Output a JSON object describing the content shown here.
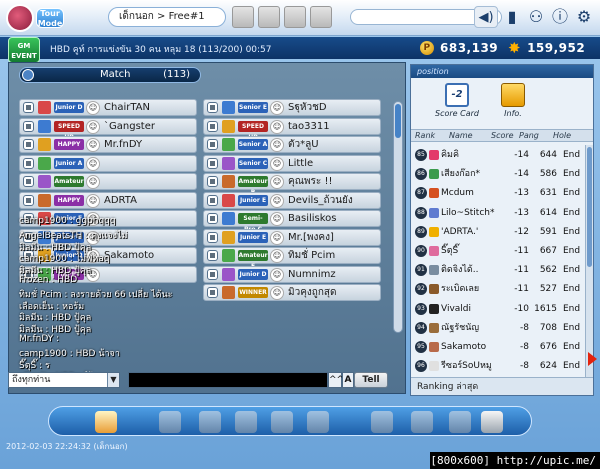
{
  "header": {
    "logo_text": "Tour Mode",
    "room_title": "เด็กนอก > Free#1",
    "buttons": {
      "speaker": "speaker-icon"
    }
  },
  "infobar": {
    "gm_label": "GM EVENT",
    "room_info": "HBD คูท์    การแข่งขัน 30 คน    หลุม 18  (113/200)  00:57",
    "coins": "683,139",
    "stars": "159,952"
  },
  "main_tab": {
    "label": "Match",
    "count": "(113)"
  },
  "left_rows": [
    {
      "name": "ChairTAN",
      "rank": "Junior D",
      "color": "#2b62b8"
    },
    {
      "name": "`Gangster",
      "rank": "SPEED UP",
      "color": "#b32424"
    },
    {
      "name": "Mr.fnDY",
      "rank": "HAPPY",
      "color": "#8b2fa6"
    },
    {
      "name": "",
      "rank": "Junior A",
      "color": "#2b62b8"
    },
    {
      "name": "",
      "rank": "Amateur",
      "color": "#2e7a2e"
    },
    {
      "name": "ADRTA",
      "rank": "HAPPY",
      "color": "#8b2fa6"
    },
    {
      "name": "",
      "rank": "Junior E",
      "color": "#2b62b8"
    },
    {
      "name": "",
      "rank": "Junior E",
      "color": "#2b62b8"
    },
    {
      "name": "Sakamoto",
      "rank": "Junior D",
      "color": "#2b62b8"
    },
    {
      "name": "",
      "rank": "HAPPY",
      "color": "#8b2fa6"
    }
  ],
  "right_rows": [
    {
      "name": "SฐุหัวชD",
      "rank": "Senior E",
      "color": "#2b62b8"
    },
    {
      "name": "tao3311",
      "rank": "SPEED UP",
      "color": "#b32424"
    },
    {
      "name": "ตัว*ลูU",
      "rank": "Senior A",
      "color": "#2b62b8"
    },
    {
      "name": "Little",
      "rank": "Senior C",
      "color": "#2b62b8"
    },
    {
      "name": "คุณพระ !!",
      "rank": "Amateur B",
      "color": "#2e7a2e"
    },
    {
      "name": "Devils_ถ้วนยัง",
      "rank": "Junior E",
      "color": "#2b62b8"
    },
    {
      "name": "Basiliskos",
      "rank": "Semi-Pro C",
      "color": "#2e7a2e"
    },
    {
      "name": "Mr.[พงคง]",
      "rank": "Junior E",
      "color": "#2b62b8"
    },
    {
      "name": "ทิมชั่ Pcim",
      "rank": "Amateur E",
      "color": "#2e7a2e"
    },
    {
      "name": "Numnimz",
      "rank": "Junior D",
      "color": "#2b62b8"
    },
    {
      "name": "มิวคุงถูกสุด",
      "rank": "WINNER",
      "color": "#c28800"
    }
  ],
  "chat": [
    "camp1900 : ggphqqq",
    "AngelBeatsTH : คุงแจงไม่",
    "มิลมีน : HBD ปู้คุล",
    "camp1900 : ไม่ฟหaq",
    "มิลมีน : HBD ปู้คุล",
    "Frozen : HBD",
    "ทิมชั่ Pcim : ลงรายด้วย 66 เปลี่ย ได้นะ",
    "เลือดเย็น : หอร้ม",
    "มิลมีน : HBD ปู้คุล",
    "มิลมีน : HBD ปู้คุล",
    "Mr.fnDY :",
    "camp1900 : HBD น้าจา",
    "Sิ๊ตุSิ๊ : ร",
    "zFord! : HBDคูท์ว้าาา"
  ],
  "input": {
    "channel": "ถึงทุกท่าน",
    "bold_label": "A",
    "size_label": "^^",
    "tell_label": "Tell"
  },
  "rank_panel": {
    "title": "position",
    "score_card_label": "Score Card",
    "score_card_value": "-2",
    "info_label": "Info.",
    "columns": [
      "Rank",
      "Name",
      "Score",
      "Pang",
      "Hole"
    ],
    "rows": [
      {
        "rank": "85",
        "name": "คิมคิ",
        "score": "-14",
        "pang": "644",
        "hole": "End"
      },
      {
        "rank": "86",
        "name": "เสียงก๊อก*",
        "score": "-14",
        "pang": "586",
        "hole": "End"
      },
      {
        "rank": "87",
        "name": "Mcdum",
        "score": "-13",
        "pang": "631",
        "hole": "End"
      },
      {
        "rank": "88",
        "name": "Lilo~Stitch*",
        "score": "-13",
        "pang": "614",
        "hole": "End"
      },
      {
        "rank": "89",
        "name": "'ADRTA.'",
        "score": "-12",
        "pang": "591",
        "hole": "End"
      },
      {
        "rank": "90",
        "name": "Sิ๊ตุSิ๊",
        "score": "-11",
        "pang": "667",
        "hole": "End"
      },
      {
        "rank": "91",
        "name": "ติดจิงได้..",
        "score": "-11",
        "pang": "562",
        "hole": "End"
      },
      {
        "rank": "92",
        "name": "ระเบิดเลย",
        "score": "-11",
        "pang": "527",
        "hole": "End"
      },
      {
        "rank": "93",
        "name": "Vivaldi",
        "score": "-10",
        "pang": "1615",
        "hole": "End"
      },
      {
        "rank": "94",
        "name": "ณัฐรัชนัญ",
        "score": "-8",
        "pang": "708",
        "hole": "End"
      },
      {
        "rank": "95",
        "name": "Sakamoto",
        "score": "-8",
        "pang": "676",
        "hole": "End"
      },
      {
        "rank": "96",
        "name": "รีซอร์SoUหมู",
        "score": "-8",
        "pang": "624",
        "hole": "End"
      }
    ],
    "footer": "Ranking ล่าสุด"
  },
  "taskbar": {
    "icons": [
      "club-icon",
      "ball-icon",
      "lucky-icon",
      "shop-icon",
      "gift-icon",
      "settings-icon",
      "bag-icon",
      "friends-icon",
      "camera-icon",
      "exit-icon"
    ]
  },
  "timestamp": "2012-02-03 22:24:32 (เด็กนอก)",
  "watermark": "[800x600] http://upic.me/",
  "colors": {
    "accent": "#1a4a82",
    "panel": "#6e8ea8",
    "coin": "#ffb000"
  }
}
